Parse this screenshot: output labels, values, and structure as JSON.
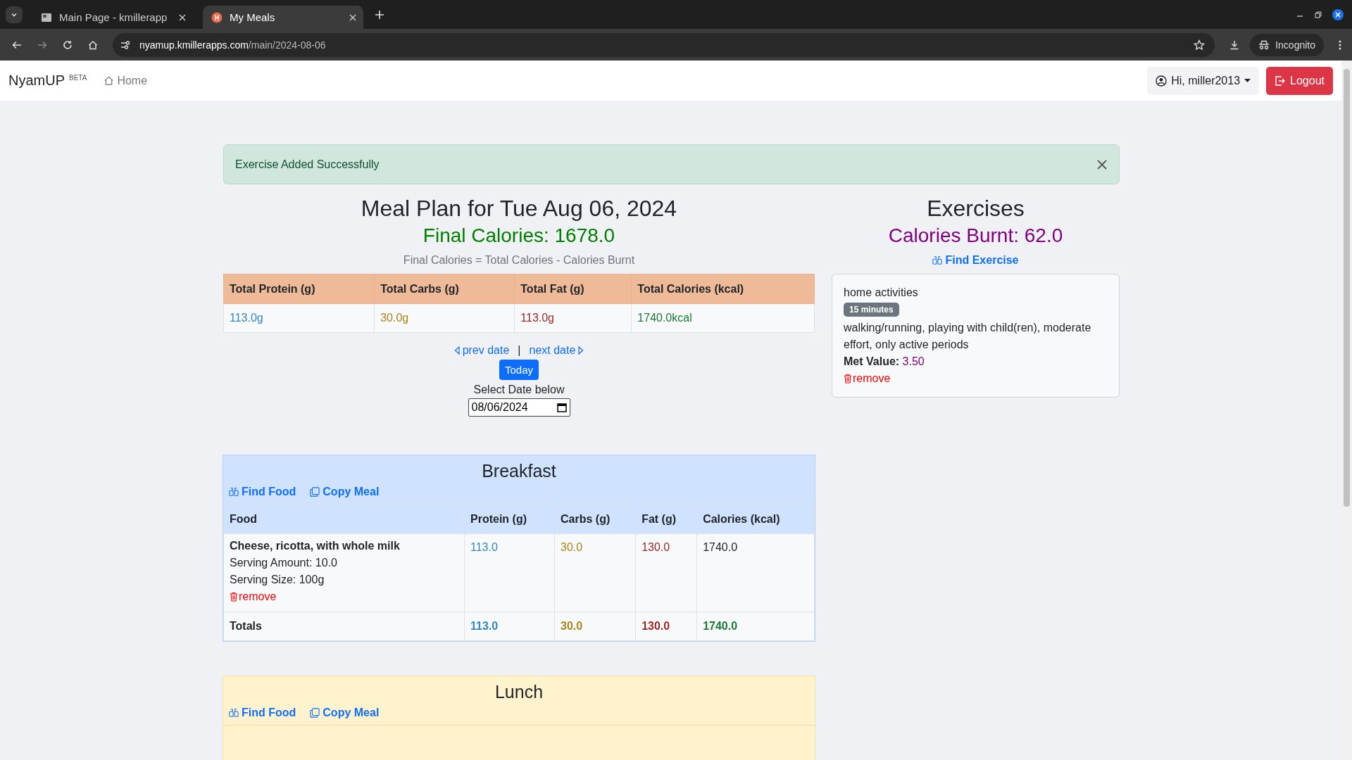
{
  "browser": {
    "tabs": [
      {
        "title": "Main Page - kmillerapp",
        "kind": "page",
        "selected": false
      },
      {
        "title": "My Meals",
        "kind": "app",
        "selected": true
      }
    ],
    "url_host": "nyamup.kmillerapps.com",
    "url_path": "/main/2024-08-06",
    "incognito": "Incognito"
  },
  "navbar": {
    "brand": "NyamUP",
    "badge": "BETA",
    "home": "Home",
    "user": "Hi, miller2013",
    "logout": "Logout"
  },
  "alert": "Exercise Added Successfully",
  "meal_plan": {
    "title": "Meal Plan for Tue Aug 06, 2024",
    "final_calories": "Final Calories: 1678.0",
    "formula": "Final Calories = Total Calories - Calories Burnt",
    "summary_columns": [
      "Total Protein (g)",
      "Total Carbs (g)",
      "Total Fat (g)",
      "Total Calories (kcal)"
    ],
    "summary_values": [
      "113.0g",
      "30.0g",
      "113.0g",
      "1740.0kcal"
    ],
    "prev": "prev date",
    "separator": "|",
    "next": "next date",
    "today": "Today",
    "date_label": "Select Date below",
    "date_value": "08/06/2024"
  },
  "exercises": {
    "title": "Exercises",
    "calories_burnt": "Calories Burnt: 62.0",
    "find": "Find Exercise",
    "items": [
      {
        "category": "home activities",
        "duration": "15 minutes",
        "description": "walking/running, playing with child(ren), moderate effort, only active periods",
        "met_label": "Met Value:",
        "met_value": "3.50",
        "remove": "remove"
      }
    ]
  },
  "meals": [
    {
      "title": "Breakfast",
      "kind": "breakfast",
      "find": "Find Food",
      "copy": "Copy Meal",
      "columns": [
        "Food",
        "Protein (g)",
        "Carbs (g)",
        "Fat (g)",
        "Calories (kcal)"
      ],
      "items": [
        {
          "name": "Cheese, ricotta, with whole milk",
          "amount": "Serving Amount: 10.0",
          "size": "Serving Size: 100g",
          "remove": "remove",
          "values": [
            "113.0",
            "30.0",
            "130.0",
            "1740.0"
          ]
        }
      ],
      "totals": {
        "label": "Totals",
        "values": [
          "113.0",
          "30.0",
          "130.0",
          "1740.0"
        ]
      }
    },
    {
      "title": "Lunch",
      "kind": "lunch",
      "find": "Find Food",
      "copy": "Copy Meal"
    }
  ]
}
